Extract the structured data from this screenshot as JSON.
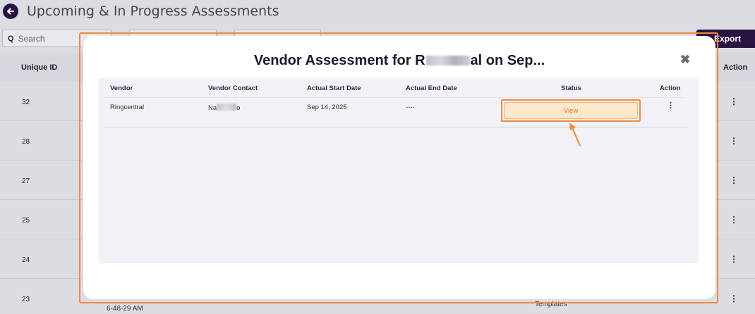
{
  "page": {
    "title": "Upcoming & In Progress Assessments",
    "search_placeholder": "Search",
    "export_label": "Export"
  },
  "background_table": {
    "columns": {
      "id": "Unique ID",
      "action": "Action"
    },
    "rows": [
      {
        "id": "32"
      },
      {
        "id": "28"
      },
      {
        "id": "27"
      },
      {
        "id": "25"
      },
      {
        "id": "24"
      },
      {
        "id": "23",
        "created_fragment": "6-48-29 AM",
        "category_fragment": "Templates"
      }
    ]
  },
  "modal": {
    "title_start": "Vendor Assessment for R",
    "title_end": "al on Sep...",
    "close_symbol": "✖",
    "columns": {
      "vendor": "Vendor",
      "contact": "Vendor Contact",
      "start": "Actual Start Date",
      "end": "Actual End Date",
      "status": "Status",
      "action": "Action"
    },
    "row": {
      "vendor": "Ringcentral",
      "contact_start": "Na",
      "contact_end": "o",
      "start": "Sep 14, 2025",
      "end": "----",
      "status_button": "View",
      "action_symbol": "⋮"
    }
  },
  "colors": {
    "brand": "#2a1245",
    "highlight": "#f28a3a",
    "view_bg": "#fde8cc",
    "view_text": "#e07a20"
  }
}
